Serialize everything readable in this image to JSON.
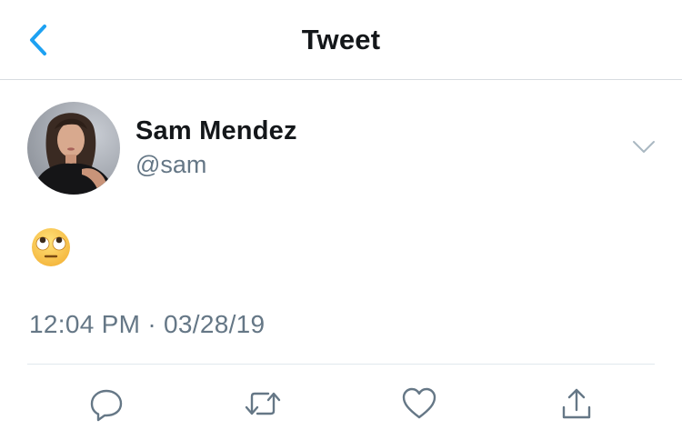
{
  "header": {
    "title": "Tweet",
    "back_icon": "chevron-left-icon",
    "accent_color": "#1da1f2"
  },
  "tweet": {
    "author_name": "Sam Mendez",
    "author_handle": "@sam",
    "avatar_icon": "avatar-photo",
    "text": "🙄",
    "timestamp": "12:04 PM · 03/28/19",
    "more_icon": "chevron-down-icon"
  },
  "actions": {
    "reply_icon": "reply-icon",
    "retweet_icon": "retweet-icon",
    "like_icon": "heart-icon",
    "share_icon": "share-icon"
  },
  "colors": {
    "text_primary": "#14171a",
    "text_secondary": "#657786",
    "divider": "#e1e8ed"
  }
}
